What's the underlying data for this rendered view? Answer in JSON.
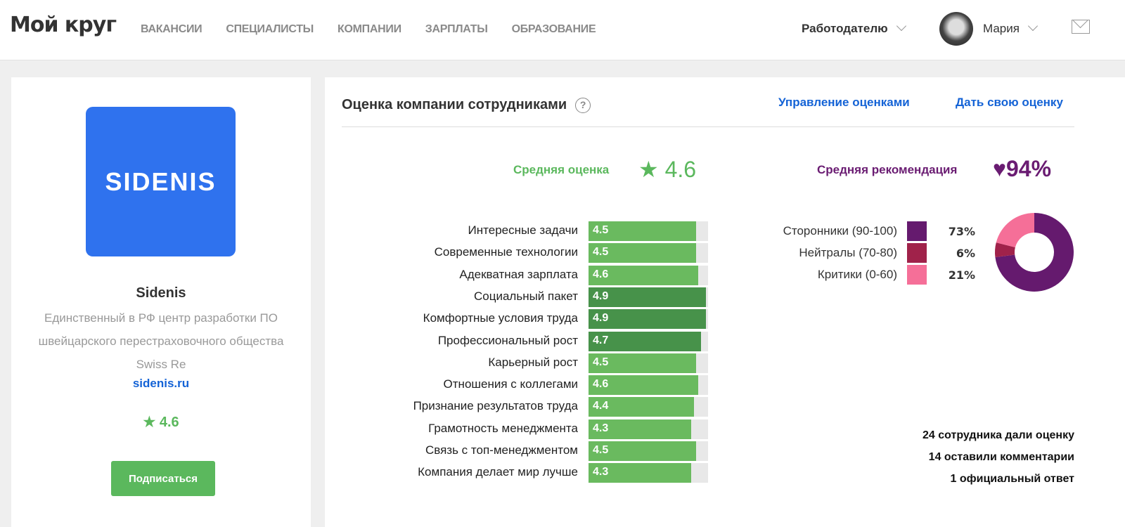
{
  "header": {
    "logo": "Мой круг",
    "nav": [
      "ВАКАНСИИ",
      "СПЕЦИАЛИСТЫ",
      "КОМПАНИИ",
      "ЗАРПЛАТЫ",
      "ОБРАЗОВАНИЕ"
    ],
    "employer": "Работодателю",
    "user": "Мария"
  },
  "company": {
    "logo_text": "SIDENIS",
    "name": "Sidenis",
    "description": "Единственный в РФ центр разработки ПО швейцарского перестраховочного общества Swiss Re",
    "link": "sidenis.ru",
    "rating": "4.6",
    "subscribe": "Подписаться"
  },
  "ratings": {
    "title": "Оценка компании сотрудниками",
    "help": "?",
    "manage": "Управление оценками",
    "give": "Дать свою оценку",
    "avg_label": "Средняя оценка",
    "avg_value": "4.6",
    "rec_label": "Средняя рекомендация",
    "rec_value": "94%",
    "items": [
      {
        "label": "Интересные задачи",
        "value": "4.5"
      },
      {
        "label": "Современные технологии",
        "value": "4.5"
      },
      {
        "label": "Адекватная зарплата",
        "value": "4.6"
      },
      {
        "label": "Социальный пакет",
        "value": "4.9"
      },
      {
        "label": "Комфортные условия труда",
        "value": "4.9"
      },
      {
        "label": "Профессиональный рост",
        "value": "4.7"
      },
      {
        "label": "Карьерный рост",
        "value": "4.5"
      },
      {
        "label": "Отношения с коллегами",
        "value": "4.6"
      },
      {
        "label": "Признание результатов труда",
        "value": "4.4"
      },
      {
        "label": "Грамотность менеджмента",
        "value": "4.3"
      },
      {
        "label": "Связь с топ-менеджментом",
        "value": "4.5"
      },
      {
        "label": "Компания делает мир лучше",
        "value": "4.3"
      }
    ],
    "legend": [
      {
        "label": "Сторонники (90-100)",
        "pct": "73%",
        "value": 73,
        "color": "#651a6e"
      },
      {
        "label": "Нейтралы (70-80)",
        "pct": "6%",
        "value": 6,
        "color": "#a0224a"
      },
      {
        "label": "Критики (0-60)",
        "pct": "21%",
        "value": 21,
        "color": "#f56f98"
      }
    ],
    "stats": [
      "24 сотрудника дали оценку",
      "14 оставили комментарии",
      "1 официальный ответ"
    ]
  },
  "colors": {
    "green": "#6aba5f",
    "dark_green": "#47924a",
    "link": "#1463d6"
  }
}
